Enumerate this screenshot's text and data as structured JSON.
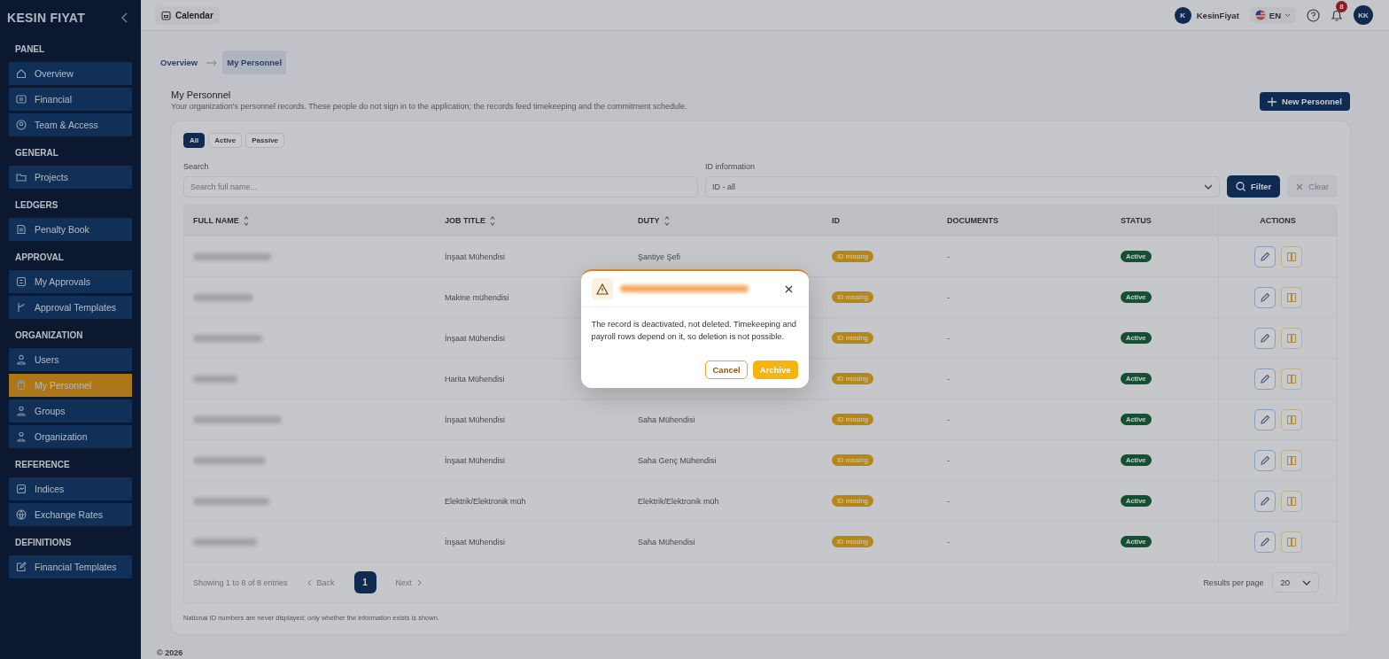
{
  "sidebar": {
    "logo": "KESIN FIYAT",
    "sections": [
      {
        "title": "PANEL",
        "items": [
          {
            "label": "Overview",
            "selected": false
          },
          {
            "label": "Financial",
            "selected": false
          },
          {
            "label": "Team & Access",
            "selected": false
          }
        ]
      },
      {
        "title": "GENERAL",
        "items": [
          {
            "label": "Projects",
            "selected": false
          }
        ]
      },
      {
        "title": "LEDGERS",
        "items": [
          {
            "label": "Penalty Book",
            "selected": false
          }
        ]
      },
      {
        "title": "APPROVAL",
        "items": [
          {
            "label": "My Approvals",
            "selected": false
          },
          {
            "label": "Approval Templates",
            "selected": false
          }
        ]
      },
      {
        "title": "ORGANIZATION",
        "items": [
          {
            "label": "Users",
            "selected": false
          },
          {
            "label": "My Personnel",
            "selected": true
          },
          {
            "label": "Groups",
            "selected": false
          },
          {
            "label": "Organization",
            "selected": false
          }
        ]
      },
      {
        "title": "REFERENCE",
        "items": [
          {
            "label": "Indices",
            "selected": false
          },
          {
            "label": "Exchange Rates",
            "selected": false
          }
        ]
      },
      {
        "title": "DEFINITIONS",
        "items": [
          {
            "label": "Financial Templates",
            "selected": false
          }
        ]
      }
    ]
  },
  "topbar": {
    "calendar": "Calendar",
    "user_initial": "K",
    "user_name": "KesinFiyat",
    "language": "EN",
    "notifications": "8",
    "avatar": "KK"
  },
  "breadcrumb": [
    {
      "label": "Overview",
      "selected": false
    },
    {
      "label": "My Personnel",
      "selected": true
    }
  ],
  "page": {
    "title": "My Personnel",
    "description": "Your organization's personnel records. These people do not sign in to the application; the records feed timekeeping and the commitment schedule.",
    "new_button": "New Personnel"
  },
  "filter_tabs": [
    {
      "label": "All",
      "selected": true
    },
    {
      "label": "Active",
      "selected": false
    },
    {
      "label": "Passive",
      "selected": false
    }
  ],
  "search": {
    "label": "Search",
    "placeholder": "Search full name..."
  },
  "id_filter": {
    "label": "ID information",
    "value": "ID - all"
  },
  "filter_button": "Filter",
  "clear_button": {
    "label": "Clear",
    "disabled": true
  },
  "table": {
    "columns": [
      {
        "label": "FULL NAME",
        "sortable": true
      },
      {
        "label": "JOB TITLE",
        "sortable": true
      },
      {
        "label": "DUTY",
        "sortable": true
      },
      {
        "label": "ID",
        "sortable": false
      },
      {
        "label": "DOCUMENTS",
        "sortable": false
      },
      {
        "label": "STATUS",
        "sortable": false
      },
      {
        "label": "ACTIONS",
        "sortable": false
      }
    ],
    "rows": [
      {
        "job_title": "İnşaat Mühendisi",
        "duty": "Şantiye Şefi",
        "id": "ID missing",
        "documents": "-",
        "status": "Active"
      },
      {
        "job_title": "Makine mühendisi",
        "id": "ID missing",
        "documents": "-",
        "status": "Active"
      },
      {
        "job_title": "İnşaat Mühendisi",
        "id": "ID missing",
        "documents": "-",
        "status": "Active"
      },
      {
        "job_title": "Harita Mühendisi",
        "id": "ID missing",
        "documents": "-",
        "status": "Active"
      },
      {
        "job_title": "İnşaat Mühendisi",
        "duty": "Saha Mühendisi",
        "id": "ID missing",
        "documents": "-",
        "status": "Active"
      },
      {
        "job_title": "İnşaat Mühendisi",
        "duty": "Saha Genç Mühendisi",
        "id": "ID missing",
        "documents": "-",
        "status": "Active"
      },
      {
        "job_title": "Elektrik/Elektronik müh",
        "duty": "Elektrik/Elektronik müh",
        "id": "ID missing",
        "documents": "-",
        "status": "Active"
      },
      {
        "job_title": "İnşaat Mühendisi",
        "duty": "Saha Mühendisi",
        "id": "ID missing",
        "documents": "-",
        "status": "Active"
      }
    ]
  },
  "pagination": {
    "summary": "Showing 1 to 8 of 8 entries",
    "back": "Back",
    "pages": [
      {
        "label": "1",
        "selected": true
      }
    ],
    "next": "Next",
    "per_page_label": "Results per page",
    "per_page": "20"
  },
  "note": "National ID numbers are never displayed; only whether the information exists is shown.",
  "footer": "© 2026",
  "dialog": {
    "message": "The record is deactivated, not deleted. Timekeeping and payroll rows depend on it, so deletion is not possible.",
    "cancel": "Cancel",
    "confirm": "Archive"
  }
}
